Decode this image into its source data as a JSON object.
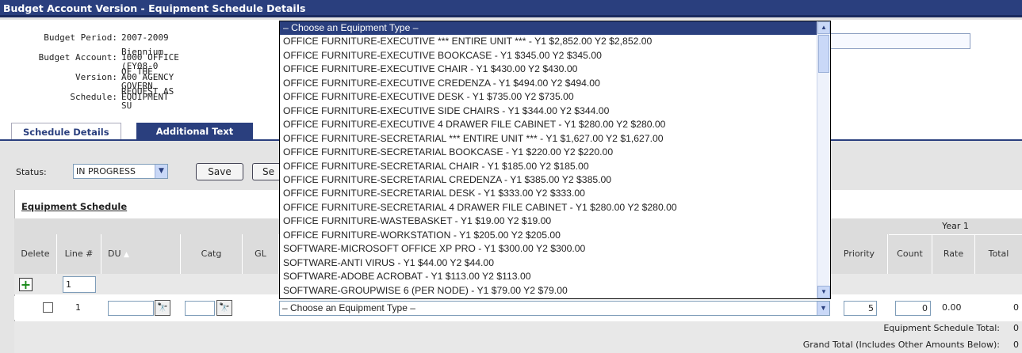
{
  "window": {
    "title": "Budget Account Version - Equipment Schedule Details"
  },
  "info": {
    "budget_period_label": "Budget Period:",
    "budget_period_value": "2007-2009 Biennium (FY08-0",
    "budget_account_label": "Budget Account:",
    "budget_account_value": "1000 OFFICE OF THE GOVERN",
    "version_label": "Version:",
    "version_value": "A00 AGENCY REQUEST AS SU",
    "schedule_label": "Schedule:",
    "schedule_value": "EQUIPMENT"
  },
  "tabs": [
    {
      "label": "Schedule Details"
    },
    {
      "label": "Additional Text"
    }
  ],
  "status": {
    "label": "Status:",
    "value": "IN PROGRESS"
  },
  "buttons": {
    "save": "Save",
    "second": "Se"
  },
  "grid": {
    "title": "Equipment Schedule",
    "year_header": "Year 1",
    "columns": {
      "delete": "Delete",
      "line": "Line #",
      "du": "DU",
      "catg": "Catg",
      "gl": "GL",
      "priority": "Priority",
      "count": "Count",
      "rate": "Rate",
      "total": "Total"
    },
    "new_line_value": "1",
    "row": {
      "line": "1",
      "equipment": "– Choose an Equipment Type –",
      "priority": "5",
      "count": "0",
      "rate": "0.00",
      "total": "0"
    }
  },
  "totals": {
    "schedule_label": "Equipment Schedule Total:",
    "schedule_value": "0",
    "grand_label": "Grand Total (Includes Other Amounts Below):",
    "grand_value": "0"
  },
  "dropdown": {
    "options": [
      "– Choose an Equipment Type –",
      "OFFICE FURNITURE-EXECUTIVE *** ENTIRE UNIT *** - Y1 $2,852.00 Y2 $2,852.00",
      "OFFICE FURNITURE-EXECUTIVE BOOKCASE - Y1 $345.00 Y2 $345.00",
      "OFFICE FURNITURE-EXECUTIVE CHAIR - Y1 $430.00 Y2 $430.00",
      "OFFICE FURNITURE-EXECUTIVE CREDENZA - Y1 $494.00 Y2 $494.00",
      "OFFICE FURNITURE-EXECUTIVE DESK - Y1 $735.00 Y2 $735.00",
      "OFFICE FURNITURE-EXECUTIVE SIDE CHAIRS - Y1 $344.00 Y2 $344.00",
      "OFFICE FURNITURE-EXECUTIVE 4 DRAWER FILE CABINET - Y1 $280.00 Y2 $280.00",
      "OFFICE FURNITURE-SECRETARIAL *** ENTIRE UNIT *** - Y1 $1,627.00 Y2 $1,627.00",
      "OFFICE FURNITURE-SECRETARIAL BOOKCASE - Y1 $220.00 Y2 $220.00",
      "OFFICE FURNITURE-SECRETARIAL CHAIR - Y1 $185.00 Y2 $185.00",
      "OFFICE FURNITURE-SECRETARIAL CREDENZA - Y1 $385.00 Y2 $385.00",
      "OFFICE FURNITURE-SECRETARIAL DESK - Y1 $333.00 Y2 $333.00",
      "OFFICE FURNITURE-SECRETARIAL 4 DRAWER FILE CABINET - Y1 $280.00 Y2 $280.00",
      "OFFICE FURNITURE-WASTEBASKET - Y1 $19.00 Y2 $19.00",
      "OFFICE FURNITURE-WORKSTATION - Y1 $205.00 Y2 $205.00",
      "SOFTWARE-MICROSOFT OFFICE XP PRO - Y1 $300.00 Y2 $300.00",
      "SOFTWARE-ANTI VIRUS - Y1 $44.00 Y2 $44.00",
      "SOFTWARE-ADOBE ACROBAT - Y1 $113.00 Y2 $113.00",
      "SOFTWARE-GROUPWISE 6 (PER NODE) - Y1 $79.00 Y2 $79.00"
    ]
  },
  "colors": {
    "accent": "#2a3f7e",
    "add_icon": "#1a8a1a"
  }
}
